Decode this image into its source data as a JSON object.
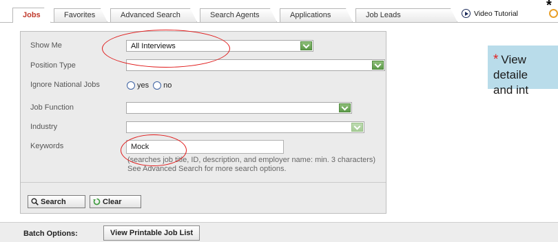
{
  "tabs": [
    {
      "label": "Jobs",
      "active": true
    },
    {
      "label": "Favorites"
    },
    {
      "label": "Advanced Search"
    },
    {
      "label": "Search Agents"
    },
    {
      "label": "Applications"
    },
    {
      "label": "Job Leads"
    }
  ],
  "video_tutorial": {
    "label": "Video Tutorial",
    "marker": "*"
  },
  "search_form": {
    "show_me": {
      "label": "Show Me",
      "value": "All Interviews"
    },
    "position_type": {
      "label": "Position Type",
      "value": ""
    },
    "ignore_national_jobs": {
      "label": "Ignore National Jobs",
      "options": [
        "yes",
        "no"
      ]
    },
    "job_function": {
      "label": "Job Function",
      "value": ""
    },
    "industry": {
      "label": "Industry",
      "value": ""
    },
    "keywords": {
      "label": "Keywords",
      "value": "Mock",
      "hint_line1": "(searches job title, ID, description, and employer name: min. 3 characters)",
      "hint_line2": "See Advanced Search for more search options."
    },
    "search_button": "Search",
    "clear_button": "Clear"
  },
  "callout": {
    "marker": "*",
    "lines": [
      "View",
      "detaile",
      "and int"
    ]
  },
  "batch": {
    "label": "Batch Options:",
    "button": "View Printable Job List"
  },
  "colors": {
    "active_tab_text": "#c0392b",
    "annotation_red": "#e01818",
    "callout_bg": "#b9dcea",
    "dropdown_green": "#5d9a4a",
    "panel_bg": "#ebebeb"
  },
  "icons": [
    "play-circle-icon",
    "search-icon",
    "clear-icon",
    "dropdown-arrow-icon"
  ]
}
